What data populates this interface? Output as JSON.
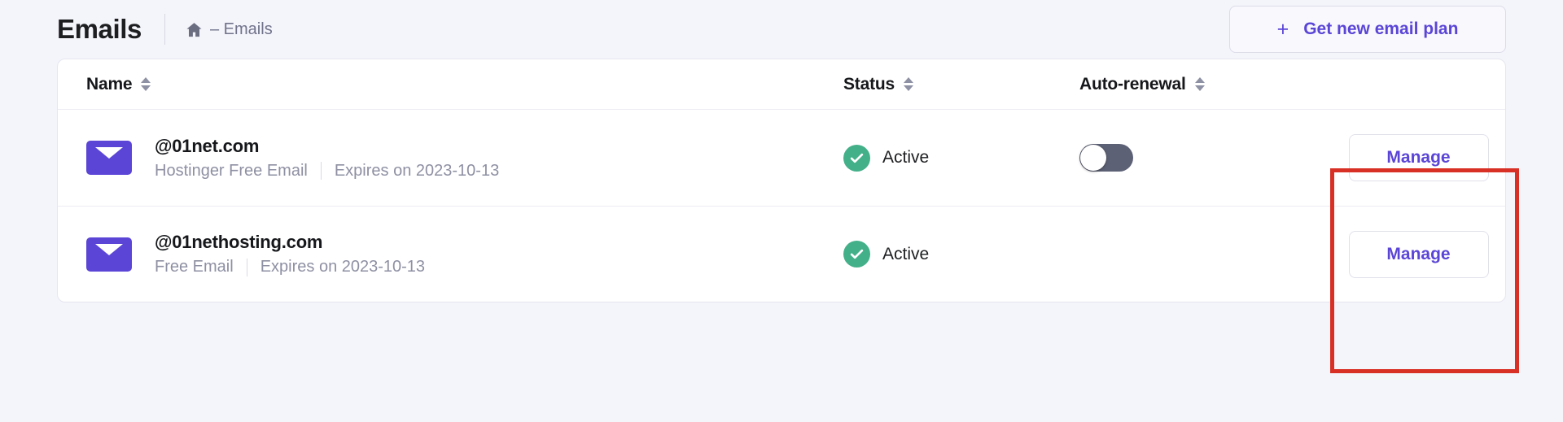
{
  "header": {
    "title": "Emails",
    "breadcrumb": {
      "home_icon": "home-icon",
      "text": "– Emails"
    },
    "new_plan_button": {
      "icon": "plus-icon",
      "label": "Get new email plan"
    }
  },
  "table": {
    "columns": [
      {
        "key": "name",
        "label": "Name",
        "sortable": true
      },
      {
        "key": "status",
        "label": "Status",
        "sortable": true
      },
      {
        "key": "renewal",
        "label": "Auto-renewal",
        "sortable": true
      },
      {
        "key": "action",
        "label": "",
        "sortable": false
      }
    ],
    "rows": [
      {
        "icon": "envelope-icon",
        "domain": "@01net.com",
        "plan": "Hostinger Free Email",
        "expiry": "Expires on 2023-10-13",
        "status": "Active",
        "status_icon": "check-circle-icon",
        "auto_renewal": {
          "present": true,
          "on": false
        },
        "action_label": "Manage"
      },
      {
        "icon": "envelope-icon",
        "domain": "@01nethosting.com",
        "plan": "Free Email",
        "expiry": "Expires on 2023-10-13",
        "status": "Active",
        "status_icon": "check-circle-icon",
        "auto_renewal": {
          "present": false,
          "on": false
        },
        "action_label": "Manage"
      }
    ]
  },
  "annotation": {
    "color": "#d93025",
    "target": "manage-buttons-column"
  },
  "colors": {
    "page_background": "#f4f4fb",
    "brand_purple": "#5a45d6",
    "status_green": "#43b089",
    "toggle_track_off": "#5d6175",
    "annotation_red": "#d93025"
  }
}
